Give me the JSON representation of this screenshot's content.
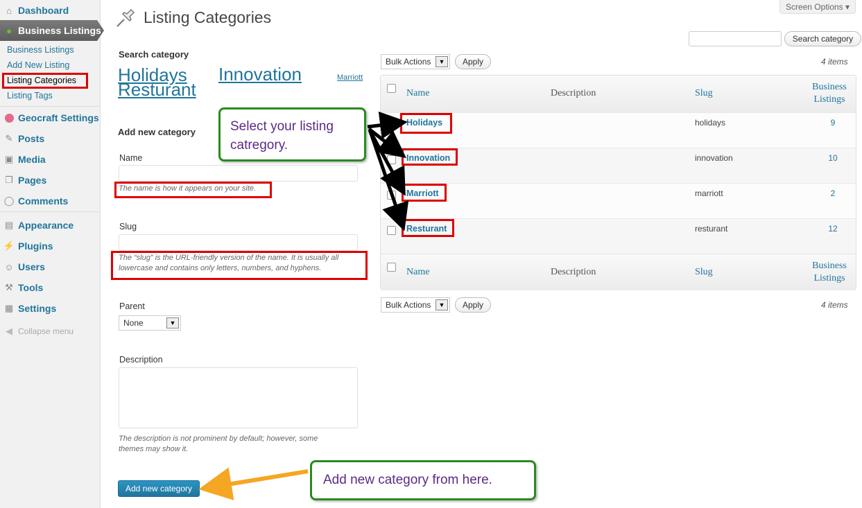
{
  "sidebar": {
    "dashboard": "Dashboard",
    "business_listings": "Business Listings",
    "sub": [
      "Business Listings",
      "Add New Listing",
      "Listing Categories",
      "Listing Tags"
    ],
    "geocraft": "Geocraft Settings",
    "posts": "Posts",
    "media": "Media",
    "pages": "Pages",
    "comments": "Comments",
    "appearance": "Appearance",
    "plugins": "Plugins",
    "users": "Users",
    "tools": "Tools",
    "settings": "Settings",
    "collapse": "Collapse menu"
  },
  "header": {
    "title": "Listing Categories",
    "screen_options": "Screen Options ▾",
    "search_button": "Search category"
  },
  "left": {
    "search_heading": "Search category",
    "tags": [
      "Holidays",
      "Innovation",
      "Marriott",
      "Resturant"
    ],
    "add_heading": "Add new category",
    "name_label": "Name",
    "name_hint": "The name is how it appears on your site.",
    "slug_label": "Slug",
    "slug_hint_1": "The “slug” is the URL-friendly version of the name. It is usually all",
    "slug_hint_2": "lowercase and contains only letters, numbers, and hyphens.",
    "parent_label": "Parent",
    "parent_value": "None",
    "description_label": "Description",
    "description_hint_1": "The description is not prominent by default; however, some",
    "description_hint_2": "themes may show it.",
    "add_button": "Add new category"
  },
  "table": {
    "bulk_actions": "Bulk Actions",
    "apply": "Apply",
    "items_count": "4 items",
    "columns": {
      "name": "Name",
      "description": "Description",
      "slug": "Slug",
      "count_1": "Business",
      "count_2": "Listings"
    },
    "rows": [
      {
        "name": "Holidays",
        "slug": "holidays",
        "count": "9"
      },
      {
        "name": "Innovation",
        "slug": "innovation",
        "count": "10"
      },
      {
        "name": "Marriott",
        "slug": "marriott",
        "count": "2"
      },
      {
        "name": "Resturant",
        "slug": "resturant",
        "count": "12"
      }
    ]
  },
  "callouts": {
    "select_1": "Select your listing",
    "select_2": "catregory.",
    "add": "Add new category from here."
  },
  "colors": {
    "link": "#21759b",
    "annotation_red": "#dd0000",
    "callout_border": "#2a8a1e",
    "callout_text": "#5b2a86",
    "orange_arrow": "#f5a623"
  }
}
